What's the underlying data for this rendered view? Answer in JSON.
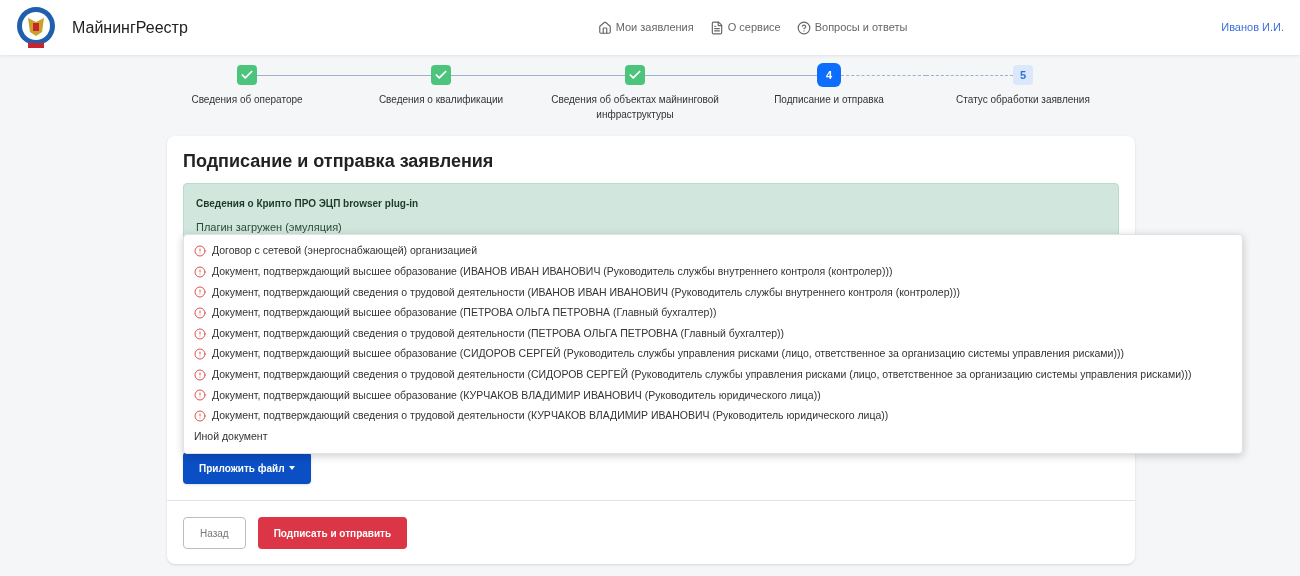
{
  "header": {
    "brand": "МайнингРеестр",
    "nav": [
      {
        "label": "Мои заявления",
        "kind": "home"
      },
      {
        "label": "О сервисе",
        "kind": "doc"
      },
      {
        "label": "Вопросы и ответы",
        "kind": "question"
      }
    ],
    "user": "Иванов И.И."
  },
  "steps": [
    {
      "label": "Сведения об операторе",
      "completed": true,
      "selected": false
    },
    {
      "label": "Сведения о квалификации",
      "completed": true,
      "selected": false
    },
    {
      "label": "Сведения об объектах майнинговой инфраструктуры",
      "completed": true,
      "selected": false
    },
    {
      "label": "Подписание и отправка",
      "completed": false,
      "selected": true,
      "number": "4"
    },
    {
      "label": "Статус обработки заявления",
      "completed": false,
      "selected": false,
      "number": "5"
    }
  ],
  "card": {
    "title": "Подписание и отправка заявления",
    "alert": {
      "title": "Сведения о Крипто ПРО ЭЦП browser plug-in",
      "text": "Плагин загружен (эмуляция)"
    },
    "menu": [
      {
        "label": "Договор с сетевой (энергоснабжающей) организацией",
        "kind": "warning"
      },
      {
        "label": "Документ, подтверждающий высшее образование (ИВАНОВ ИВАН ИВАНОВИЧ (Руководитель службы внутреннего контроля (контролер)))",
        "kind": "warning"
      },
      {
        "label": "Документ, подтверждающий сведения о трудовой деятельности (ИВАНОВ ИВАН ИВАНОВИЧ (Руководитель службы внутреннего контроля (контролер)))",
        "kind": "warning"
      },
      {
        "label": "Документ, подтверждающий высшее образование (ПЕТРОВА ОЛЬГА ПЕТРОВНА (Главный бухгалтер))",
        "kind": "warning"
      },
      {
        "label": "Документ, подтверждающий сведения о трудовой деятельности (ПЕТРОВА ОЛЬГА ПЕТРОВНА (Главный бухгалтер))",
        "kind": "warning"
      },
      {
        "label": "Документ, подтверждающий высшее образование (СИДОРОВ СЕРГЕЙ (Руководитель службы управления рисками (лицо, ответственное за организацию системы управления рисками)))",
        "kind": "warning"
      },
      {
        "label": "Документ, подтверждающий сведения о трудовой деятельности (СИДОРОВ СЕРГЕЙ (Руководитель службы управления рисками (лицо, ответственное за организацию системы управления рисками)))",
        "kind": "warning"
      },
      {
        "label": "Документ, подтверждающий высшее образование (КУРЧАКОВ ВЛАДИМИР ИВАНОВИЧ (Руководитель юридического лица))",
        "kind": "warning"
      },
      {
        "label": "Документ, подтверждающий сведения о трудовой деятельности (КУРЧАКОВ ВЛАДИМИР ИВАНОВИЧ (Руководитель юридического лица))",
        "kind": "warning"
      },
      {
        "label": "Иной документ",
        "kind": "plain"
      }
    ],
    "attach_button": "Приложить файл",
    "back_button": "Назад",
    "submit_button": "Подписать и отправить"
  }
}
